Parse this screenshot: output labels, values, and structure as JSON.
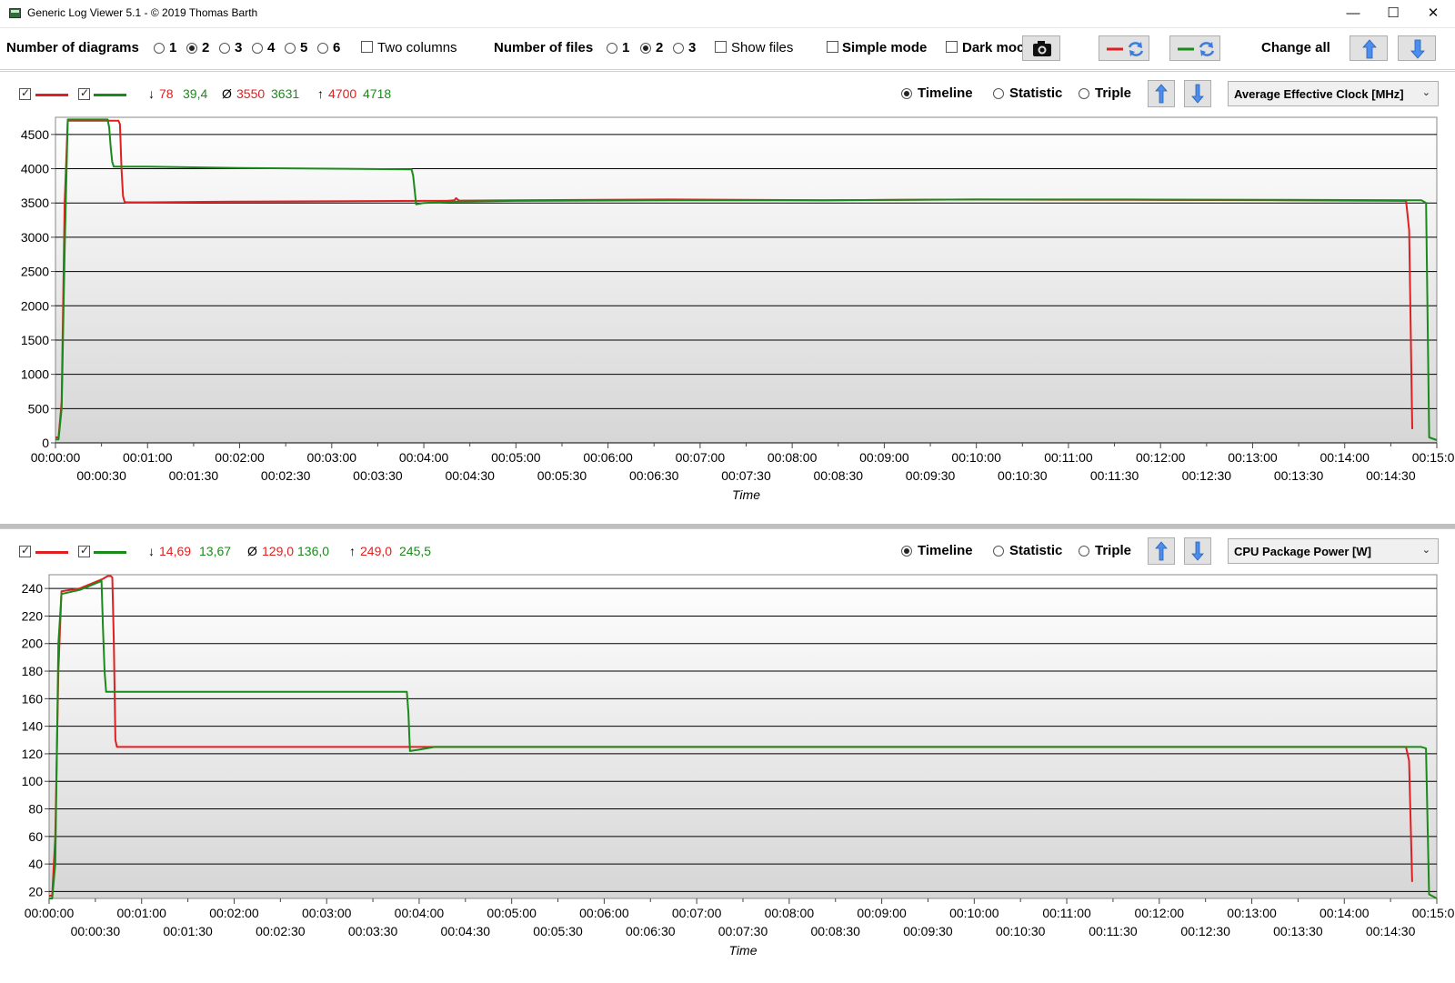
{
  "window": {
    "title": "Generic Log Viewer 5.1 - © 2019 Thomas Barth",
    "minimize": "—",
    "maximize": "☐",
    "close": "✕"
  },
  "toolbar": {
    "num_diagrams_label": "Number of diagrams",
    "diagram_options": [
      "1",
      "2",
      "3",
      "4",
      "5",
      "6"
    ],
    "diagram_selected": "2",
    "two_columns_label": "Two columns",
    "num_files_label": "Number of files",
    "file_options": [
      "1",
      "2",
      "3"
    ],
    "file_selected": "2",
    "show_files_label": "Show files",
    "simple_mode_label": "Simple mode",
    "dark_mode_label": "Dark moc",
    "change_all_label": "Change all"
  },
  "colors": {
    "red": "#e02020",
    "green": "#1a8a1a",
    "grid": "#000000",
    "accent_blue": "#3a7be0"
  },
  "panels": [
    {
      "stats": {
        "min_symbol": "↓",
        "min_red": "78",
        "min_green": "39,4",
        "avg_symbol": "Ø",
        "avg_red": "3550",
        "avg_green": "3631",
        "max_symbol": "↑",
        "max_red": "4700",
        "max_green": "4718"
      },
      "modes": [
        "Timeline",
        "Statistic",
        "Triple"
      ],
      "mode_selected": "Timeline",
      "sensor": "Average Effective Clock [MHz]"
    },
    {
      "stats": {
        "min_symbol": "↓",
        "min_red": "14,69",
        "min_green": "13,67",
        "avg_symbol": "Ø",
        "avg_red": "129,0",
        "avg_green": "136,0",
        "max_symbol": "↑",
        "max_red": "249,0",
        "max_green": "245,5"
      },
      "modes": [
        "Timeline",
        "Statistic",
        "Triple"
      ],
      "mode_selected": "Timeline",
      "sensor": "CPU Package Power [W]"
    }
  ],
  "chart_data": [
    {
      "type": "line",
      "xlabel": "Time",
      "ylabel": "",
      "xlim": [
        0,
        900
      ],
      "ylim": [
        0,
        4750
      ],
      "yticks": [
        0,
        500,
        1000,
        1500,
        2000,
        2500,
        3000,
        3500,
        4000,
        4500
      ],
      "xticks_major": [
        "00:00:00",
        "00:01:00",
        "00:02:00",
        "00:03:00",
        "00:04:00",
        "00:05:00",
        "00:06:00",
        "00:07:00",
        "00:08:00",
        "00:09:00",
        "00:10:00",
        "00:11:00",
        "00:12:00",
        "00:13:00",
        "00:14:00",
        "00:15:00"
      ],
      "xticks_minor": [
        "00:00:30",
        "00:01:30",
        "00:02:30",
        "00:03:30",
        "00:04:30",
        "00:05:30",
        "00:06:30",
        "00:07:30",
        "00:08:30",
        "00:09:30",
        "00:10:30",
        "00:11:30",
        "00:12:30",
        "00:13:30",
        "00:14:30"
      ],
      "grid": true,
      "series": [
        {
          "color": "red",
          "x": [
            0,
            2,
            4,
            6,
            8,
            40,
            41,
            42,
            43,
            44,
            45,
            46,
            60,
            120,
            240,
            255,
            260,
            261,
            262,
            263,
            300,
            400,
            500,
            600,
            700,
            800,
            880,
            882,
            884
          ],
          "y": [
            80,
            80,
            600,
            3500,
            4700,
            4700,
            4700,
            4650,
            4000,
            3600,
            3520,
            3510,
            3510,
            3520,
            3530,
            3530,
            3540,
            3570,
            3550,
            3535,
            3540,
            3550,
            3540,
            3550,
            3545,
            3540,
            3530,
            3100,
            200
          ]
        },
        {
          "color": "green",
          "x": [
            0,
            2,
            4,
            6,
            8,
            33,
            34,
            35,
            36,
            37,
            38,
            39,
            60,
            120,
            180,
            230,
            232,
            233,
            234,
            235,
            240,
            260,
            300,
            400,
            500,
            600,
            700,
            800,
            890,
            893,
            895,
            900
          ],
          "y": [
            50,
            50,
            500,
            2800,
            4718,
            4718,
            4718,
            4600,
            4300,
            4100,
            4030,
            4030,
            4030,
            4010,
            4000,
            3990,
            3990,
            3900,
            3700,
            3480,
            3500,
            3520,
            3530,
            3540,
            3540,
            3550,
            3550,
            3545,
            3540,
            3500,
            80,
            40
          ]
        }
      ]
    },
    {
      "type": "line",
      "xlabel": "Time",
      "ylabel": "",
      "xlim": [
        0,
        900
      ],
      "ylim": [
        15,
        250
      ],
      "yticks": [
        20,
        40,
        60,
        80,
        100,
        120,
        140,
        160,
        180,
        200,
        220,
        240
      ],
      "xticks_major": [
        "00:00:00",
        "00:01:00",
        "00:02:00",
        "00:03:00",
        "00:04:00",
        "00:05:00",
        "00:06:00",
        "00:07:00",
        "00:08:00",
        "00:09:00",
        "00:10:00",
        "00:11:00",
        "00:12:00",
        "00:13:00",
        "00:14:00",
        "00:15:00"
      ],
      "xticks_minor": [
        "00:00:30",
        "00:01:30",
        "00:02:30",
        "00:03:30",
        "00:04:30",
        "00:05:30",
        "00:06:30",
        "00:07:30",
        "00:08:30",
        "00:09:30",
        "00:10:30",
        "00:11:30",
        "00:12:30",
        "00:13:30",
        "00:14:30"
      ],
      "grid": true,
      "series": [
        {
          "color": "red",
          "x": [
            0,
            2,
            4,
            6,
            8,
            20,
            35,
            38,
            40,
            41,
            42,
            43,
            44,
            60,
            120,
            240,
            300,
            400,
            500,
            600,
            700,
            800,
            880,
            882,
            884
          ],
          "y": [
            17,
            17,
            60,
            180,
            238,
            240,
            247,
            249,
            249,
            248,
            200,
            130,
            125,
            125,
            125,
            125,
            125,
            125,
            125,
            125,
            125,
            125,
            125,
            115,
            27
          ]
        },
        {
          "color": "green",
          "x": [
            0,
            2,
            4,
            6,
            8,
            20,
            33,
            34,
            35,
            36,
            37,
            38,
            60,
            120,
            180,
            230,
            232,
            233,
            234,
            240,
            250,
            300,
            400,
            500,
            600,
            700,
            800,
            890,
            893,
            895,
            900
          ],
          "y": [
            15,
            15,
            40,
            200,
            236,
            239,
            245,
            246,
            210,
            180,
            165,
            165,
            165,
            165,
            165,
            165,
            165,
            150,
            122,
            123,
            125,
            125,
            125,
            125,
            125,
            125,
            125,
            125,
            124,
            18,
            15
          ]
        }
      ]
    }
  ]
}
